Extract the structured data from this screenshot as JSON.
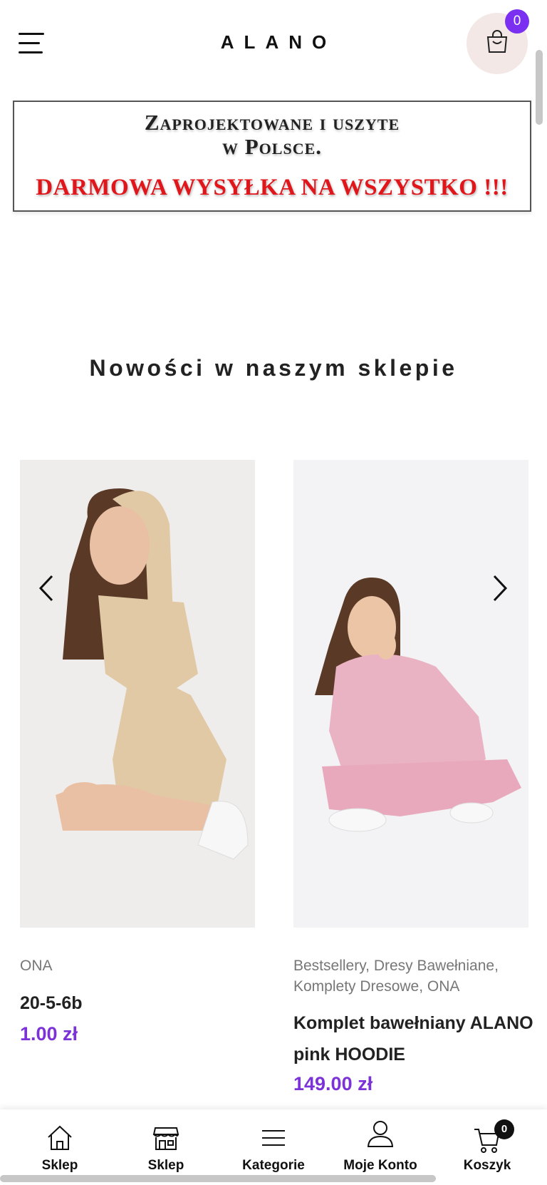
{
  "header": {
    "logo": "ALANO",
    "cart_count": "0"
  },
  "banner": {
    "line1": "Zaprojektowane i uszyte",
    "line2": "w Polsce.",
    "line3": "DARMOWA WYSYŁKA NA WSZYSTKO !!!"
  },
  "section": {
    "title": "Nowości w naszym sklepie"
  },
  "products": [
    {
      "category": "ONA",
      "name": "20-5-6b",
      "price": "1.00 zł"
    },
    {
      "category": "Bestsellery, Dresy Bawełniane, Komplety Dresowe, ONA",
      "name": "Komplet bawełniany ALANO pink HOODIE",
      "price": "149.00 zł"
    }
  ],
  "bottom_nav": [
    {
      "label": "Sklep",
      "icon": "home-icon"
    },
    {
      "label": "Sklep",
      "icon": "store-icon"
    },
    {
      "label": "Kategorie",
      "icon": "list-icon"
    },
    {
      "label": "Moje Konto",
      "icon": "user-icon"
    },
    {
      "label": "Koszyk",
      "icon": "cart-icon",
      "badge": "0"
    }
  ],
  "colors": {
    "accent": "#7b33d8",
    "banner_red": "#e0161b",
    "cart_bg": "#f3e8e6"
  }
}
